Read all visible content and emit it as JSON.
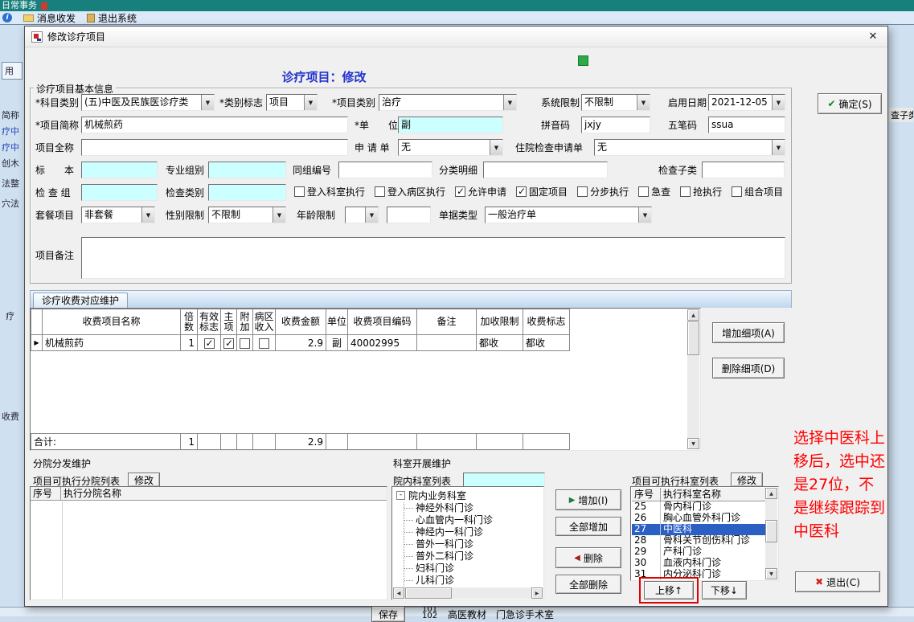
{
  "colors": {
    "highlight": "#2c5fc4",
    "annotation_red": "#ff0000",
    "field_cyan": "#ccffff",
    "heading_blue": "#2233cc",
    "top_bar_teal": "#17807d"
  },
  "icons": {
    "chevron_down": "▼",
    "scroll_up": "▲",
    "scroll_down": "▼",
    "scroll_left": "◀",
    "scroll_right": "▶",
    "close": "✕",
    "confirm_check": "✔",
    "exit_cross": "✖",
    "add_arrow": "▶",
    "remove_arrow": "◀",
    "info": "i",
    "row_pointer": "▶",
    "tree_collapse": "-"
  },
  "background": {
    "top_bar_title": "日常事务",
    "menu": [
      {
        "label": "消息收发"
      },
      {
        "label": "退出系统"
      }
    ],
    "left_fragments": [
      "用",
      "简称",
      "疗中",
      "疗中",
      "创木",
      "法整",
      "穴法",
      "疗",
      "收费"
    ],
    "right_fragment": "查子类",
    "bottom": {
      "save": "保存",
      "num_top": "101",
      "num_bottom": "102",
      "label_a": "高医教材",
      "label_b": "门急诊手术室"
    }
  },
  "dialog": {
    "title": "修改诊疗项目",
    "heading": "诊疗项目：修改",
    "confirm_button": "确定(S)",
    "exit_button": "退出(C)",
    "basic": {
      "legend": "诊疗项目基本信息",
      "subject_category": {
        "label": "*科目类别",
        "value": "(五)中医及民族医诊疗类"
      },
      "category_flag": {
        "label": "*类别标志",
        "value": "项目"
      },
      "item_category": {
        "label": "*项目类别",
        "value": "治疗"
      },
      "system_limit": {
        "label": "系统限制",
        "value": "不限制"
      },
      "start_date": {
        "label": "启用日期",
        "value": "2021-12-05"
      },
      "item_abbr": {
        "label": "*项目简称",
        "value": "机械煎药"
      },
      "unit": {
        "label": "*单　　位",
        "value": "副"
      },
      "pinyin": {
        "label": "拼音码",
        "value": "jxjy"
      },
      "wubi": {
        "label": "五笔码",
        "value": "ssua"
      },
      "full_name": {
        "label": "项目全称",
        "value": ""
      },
      "request_form": {
        "label": "申 请 单",
        "value": "无"
      },
      "inpatient_form": {
        "label": "住院检查申请单",
        "value": "无"
      },
      "specimen": {
        "label": "标　　本",
        "value": ""
      },
      "prof_group": {
        "label": "专业组别",
        "value": ""
      },
      "same_group_no": {
        "label": "同组编号",
        "value": ""
      },
      "class_detail": {
        "label": "分类明细",
        "value": ""
      },
      "check_subclass": {
        "label": "检查子类",
        "value": ""
      },
      "check_group": {
        "label": "检 查 组",
        "value": ""
      },
      "check_category": {
        "label": "检查类别",
        "value": ""
      },
      "checkboxes": [
        {
          "label": "登入科室执行",
          "checked": false
        },
        {
          "label": "登入病区执行",
          "checked": false
        },
        {
          "label": "允许申请",
          "checked": true
        },
        {
          "label": "固定项目",
          "checked": true
        },
        {
          "label": "分步执行",
          "checked": false
        },
        {
          "label": "急查",
          "checked": false
        },
        {
          "label": "抢执行",
          "checked": false
        },
        {
          "label": "组合项目",
          "checked": false
        }
      ],
      "package": {
        "label": "套餐项目",
        "value": "非套餐"
      },
      "gender_limit": {
        "label": "性别限制",
        "value": "不限制"
      },
      "age_limit": {
        "label": "年龄限制",
        "value": ""
      },
      "doc_type": {
        "label": "单据类型",
        "value": "一般治疗单"
      },
      "remark": {
        "label": "项目备注",
        "value": ""
      }
    },
    "charge": {
      "tab": "诊疗收费对应维护",
      "columns": [
        "收费项目名称",
        "倍数",
        "有效标志",
        "主项",
        "附加",
        "病区收入",
        "收费金额",
        "单位",
        "收费项目编码",
        "备注",
        "加收限制",
        "收费标志"
      ],
      "rows": [
        {
          "name": "机械煎药",
          "multiple": "1",
          "valid": true,
          "main": true,
          "extra": false,
          "ward": false,
          "amount": "2.9",
          "unit": "副",
          "code": "40002995",
          "remark": "",
          "surcharge_limit": "都收",
          "charge_flag": "都收"
        }
      ],
      "total_label": "合计:",
      "total_multiple": "1",
      "total_amount": "2.9",
      "add_button": "增加细项(A)",
      "delete_button": "删除细项(D)"
    },
    "branch": {
      "title": "分院分发维护",
      "list_label": "项目可执行分院列表",
      "modify_button": "修改",
      "col_no": "序号",
      "col_name": "执行分院名称"
    },
    "dept": {
      "title": "科室开展维护",
      "list_label": "院内科室列表",
      "search_value": "",
      "tree_root": "院内业务科室",
      "tree_items": [
        "神经外科门诊",
        "心血管内一科门诊",
        "神经内一科门诊",
        "普外一科门诊",
        "普外二科门诊",
        "妇科门诊",
        "儿科门诊"
      ],
      "add_button": "增加(I)",
      "add_all_button": "全部增加",
      "delete_button": "删除",
      "delete_all_button": "全部删除"
    },
    "exec_dept": {
      "list_label": "项目可执行科室列表",
      "modify_button": "修改",
      "col_no": "序号",
      "col_name": "执行科室名称",
      "rows": [
        {
          "no": "25",
          "name": "骨内科门诊",
          "selected": false
        },
        {
          "no": "26",
          "name": "胸心血管外科门诊",
          "selected": false
        },
        {
          "no": "27",
          "name": "中医科",
          "selected": true
        },
        {
          "no": "28",
          "name": "骨科关节创伤科门诊",
          "selected": false
        },
        {
          "no": "29",
          "name": "产科门诊",
          "selected": false
        },
        {
          "no": "30",
          "name": "血液内科门诊",
          "selected": false
        },
        {
          "no": "31",
          "name": "内分泌科门诊",
          "selected": false
        }
      ],
      "move_up_button": "上移↑",
      "move_down_button": "下移↓"
    },
    "annotation": "选择中医科上移后，选中还是27位，不是继续跟踪到中医科"
  }
}
